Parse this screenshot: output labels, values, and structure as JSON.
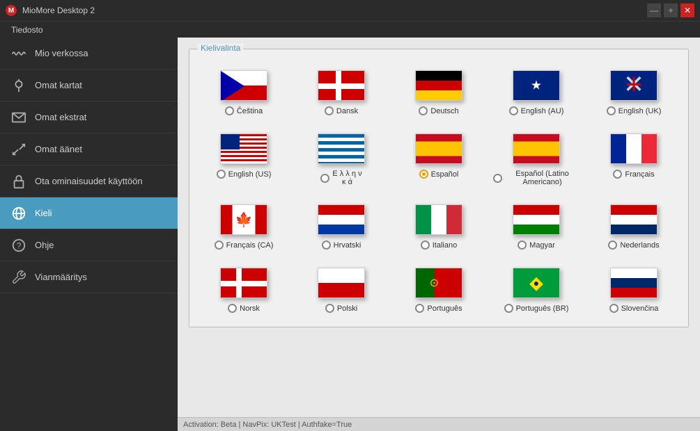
{
  "titleBar": {
    "title": "MioMore Desktop 2",
    "icon": "M",
    "controls": {
      "minimize": "—",
      "maximize": "+",
      "close": "✕"
    }
  },
  "menuBar": {
    "items": [
      {
        "label": "Tiedosto"
      }
    ]
  },
  "sidebar": {
    "items": [
      {
        "id": "mio-verkossa",
        "label": "Mio verkossa",
        "icon": "wave"
      },
      {
        "id": "omat-kartat",
        "label": "Omat kartat",
        "icon": "map"
      },
      {
        "id": "omat-ekstrat",
        "label": "Omat ekstrat",
        "icon": "mail"
      },
      {
        "id": "omat-aanet",
        "label": "Omat äänet",
        "icon": "transfer"
      },
      {
        "id": "ota-ominaisuudet",
        "label": "Ota ominaisuudet käyttöön",
        "icon": "lock"
      },
      {
        "id": "kieli",
        "label": "Kieli",
        "icon": "globe",
        "active": true
      },
      {
        "id": "ohje",
        "label": "Ohje",
        "icon": "question"
      },
      {
        "id": "vianmaaritys",
        "label": "Vianmääritys",
        "icon": "wrench"
      }
    ]
  },
  "content": {
    "panelTitle": "Kielivalinta",
    "languages": [
      {
        "id": "cs",
        "label": "Čeština",
        "flag": "cz",
        "selected": false
      },
      {
        "id": "da",
        "label": "Dansk",
        "flag": "dk",
        "selected": false
      },
      {
        "id": "de",
        "label": "Deutsch",
        "flag": "de",
        "selected": false
      },
      {
        "id": "en-au",
        "label": "English (AU)",
        "flag": "au",
        "selected": false
      },
      {
        "id": "en-uk",
        "label": "English (UK)",
        "flag": "uk",
        "selected": false
      },
      {
        "id": "en-us",
        "label": "English (US)",
        "flag": "us",
        "selected": false
      },
      {
        "id": "el",
        "label": "Ε λ λ η ν\nκ ά",
        "flag": "gr",
        "selected": false
      },
      {
        "id": "es",
        "label": "Español",
        "flag": "es",
        "selected": true
      },
      {
        "id": "es-la",
        "label": "Español (Latino Americano)",
        "flag": "es2",
        "selected": false
      },
      {
        "id": "fr",
        "label": "Français",
        "flag": "fr",
        "selected": false
      },
      {
        "id": "fr-ca",
        "label": "Français (CA)",
        "flag": "ca",
        "selected": false
      },
      {
        "id": "hr",
        "label": "Hrvatski",
        "flag": "hr",
        "selected": false
      },
      {
        "id": "it",
        "label": "Italiano",
        "flag": "it",
        "selected": false
      },
      {
        "id": "hu",
        "label": "Magyar",
        "flag": "hu",
        "selected": false
      },
      {
        "id": "nl",
        "label": "Nederlands",
        "flag": "nl",
        "selected": false
      },
      {
        "id": "no",
        "label": "Norsk",
        "flag": "no",
        "selected": false
      },
      {
        "id": "pl",
        "label": "Polski",
        "flag": "pl",
        "selected": false
      },
      {
        "id": "pt",
        "label": "Português",
        "flag": "pt",
        "selected": false
      },
      {
        "id": "pt-br",
        "label": "Português (BR)",
        "flag": "br",
        "selected": false
      },
      {
        "id": "sk",
        "label": "Slovenčina",
        "flag": "sk",
        "selected": false
      }
    ]
  },
  "statusBar": {
    "text": "Activation: Beta  |  NavPix: UKTest  |  Authfake=True"
  }
}
